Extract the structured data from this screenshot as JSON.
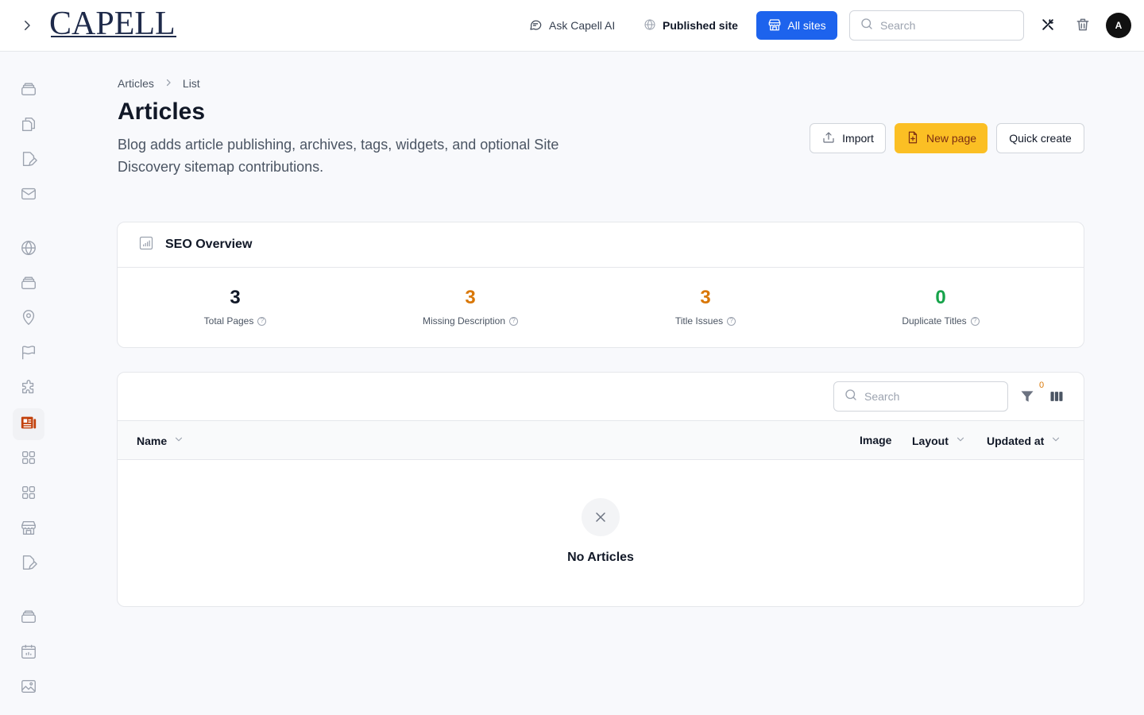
{
  "header": {
    "logo_text": "CAPELL",
    "ask_ai_label": "Ask Capell AI",
    "published_site_label": "Published site",
    "all_sites_label": "All sites",
    "search_placeholder": "Search",
    "avatar_initial": "A"
  },
  "sidebar": {
    "items": [
      {
        "icon": "stack-icon"
      },
      {
        "icon": "documents-icon"
      },
      {
        "icon": "edit-page-icon"
      },
      {
        "icon": "mail-icon"
      },
      {
        "icon": "globe-icon"
      },
      {
        "icon": "stack-icon"
      },
      {
        "icon": "map-pin-icon"
      },
      {
        "icon": "flag-icon"
      },
      {
        "icon": "puzzle-icon"
      },
      {
        "icon": "newspaper-icon",
        "active": true
      },
      {
        "icon": "grid-icon"
      },
      {
        "icon": "grid-icon"
      },
      {
        "icon": "storefront-icon"
      },
      {
        "icon": "edit-page-icon"
      },
      {
        "icon": "stack-icon"
      },
      {
        "icon": "calendar-icon"
      },
      {
        "icon": "image-icon"
      }
    ]
  },
  "breadcrumb": {
    "items": [
      "Articles",
      "List"
    ]
  },
  "page": {
    "title": "Articles",
    "description": "Blog adds article publishing, archives, tags, widgets, and optional Site Discovery sitemap contributions."
  },
  "actions": {
    "import_label": "Import",
    "new_page_label": "New page",
    "quick_create_label": "Quick create"
  },
  "seo": {
    "title": "SEO Overview",
    "stats": [
      {
        "value": "3",
        "label": "Total Pages",
        "color": "#111827"
      },
      {
        "value": "3",
        "label": "Missing Description",
        "color": "#d97706"
      },
      {
        "value": "3",
        "label": "Title Issues",
        "color": "#d97706"
      },
      {
        "value": "0",
        "label": "Duplicate Titles",
        "color": "#16a34a"
      }
    ]
  },
  "table": {
    "search_placeholder": "Search",
    "filter_count": "0",
    "columns": {
      "name": "Name",
      "image": "Image",
      "layout": "Layout",
      "updated_at": "Updated at"
    },
    "empty_text": "No Articles"
  },
  "colors": {
    "accent": "#1d63ed",
    "primary": "#fbbf24",
    "warning": "#d97706",
    "success": "#16a34a"
  }
}
